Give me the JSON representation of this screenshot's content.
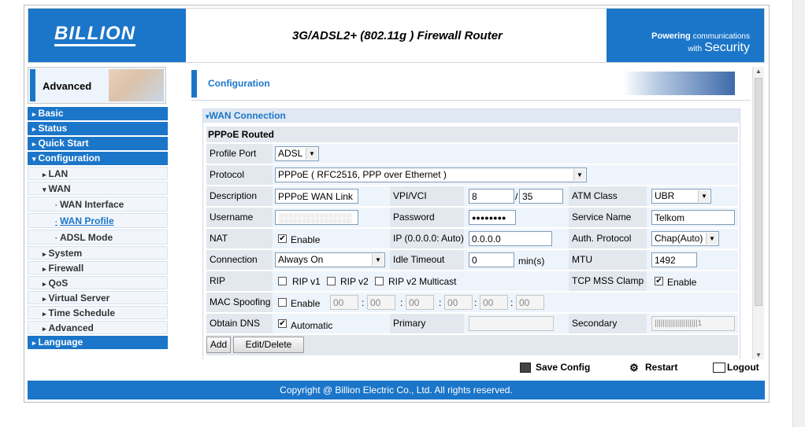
{
  "header": {
    "logo": "BILLION",
    "title": "3G/ADSL2+ (802.11g ) Firewall Router",
    "slogan_line1": "Powering",
    "slogan_line1b": "communications",
    "slogan_line2": "with",
    "slogan_line2b": "Security"
  },
  "advanced_label": "Advanced",
  "sidebar": {
    "basic": "Basic",
    "status": "Status",
    "quick_start": "Quick Start",
    "configuration": "Configuration",
    "lan": "LAN",
    "wan": "WAN",
    "wan_interface": "WAN Interface",
    "wan_profile": "WAN Profile",
    "adsl_mode": "ADSL Mode",
    "system": "System",
    "firewall": "Firewall",
    "qos": "QoS",
    "virtual_server": "Virtual Server",
    "time_schedule": "Time Schedule",
    "advanced": "Advanced",
    "language": "Language"
  },
  "content": {
    "heading": "Configuration",
    "section": "WAN Connection",
    "subsection": "PPPoE Routed"
  },
  "form": {
    "profile_port_label": "Profile Port",
    "profile_port_value": "ADSL",
    "protocol_label": "Protocol",
    "protocol_value": "PPPoE ( RFC2516, PPP over Ethernet )",
    "description_label": "Description",
    "description_value": "PPPoE WAN Link",
    "vpi_vci_label": "VPI/VCI",
    "vpi_value": "8",
    "vci_sep": "/",
    "vci_value": "35",
    "atm_class_label": "ATM Class",
    "atm_class_value": "UBR",
    "username_label": "Username",
    "username_value": "░░░░░░░░░░░",
    "password_label": "Password",
    "password_value": "●●●●●●●●",
    "service_name_label": "Service Name",
    "service_name_value": "Telkom",
    "nat_label": "NAT",
    "nat_enable": "Enable",
    "ip_label": "IP (0.0.0.0: Auto)",
    "ip_value": "0.0.0.0",
    "auth_label": "Auth. Protocol",
    "auth_value": "Chap(Auto)",
    "connection_label": "Connection",
    "connection_value": "Always On",
    "idle_label": "Idle Timeout",
    "idle_value": "0",
    "idle_unit": "min(s)",
    "mtu_label": "MTU",
    "mtu_value": "1492",
    "rip_label": "RIP",
    "rip_v1": "RIP v1",
    "rip_v2": "RIP v2",
    "rip_v2m": "RIP v2 Multicast",
    "tcp_mss_label": "TCP MSS Clamp",
    "tcp_mss_enable": "Enable",
    "mac_label": "MAC Spoofing",
    "mac_enable": "Enable",
    "mac_octet": "00",
    "obtain_dns_label": "Obtain DNS",
    "obtain_dns_auto": "Automatic",
    "primary_label": "Primary",
    "secondary_label": "Secondary",
    "secondary_value": "|||||||||||||||||||||1",
    "add_button": "Add",
    "edit_delete_button": "Edit/Delete"
  },
  "footer": {
    "save_config": "Save Config",
    "restart": "Restart",
    "logout": "Logout",
    "copyright": "Copyright @ Billion Electric Co., Ltd. All rights reserved."
  },
  "check_mark": "✔",
  "arrow_right": "▸",
  "arrow_down": "▾",
  "dd_arrow": "▼",
  "colon": ":"
}
